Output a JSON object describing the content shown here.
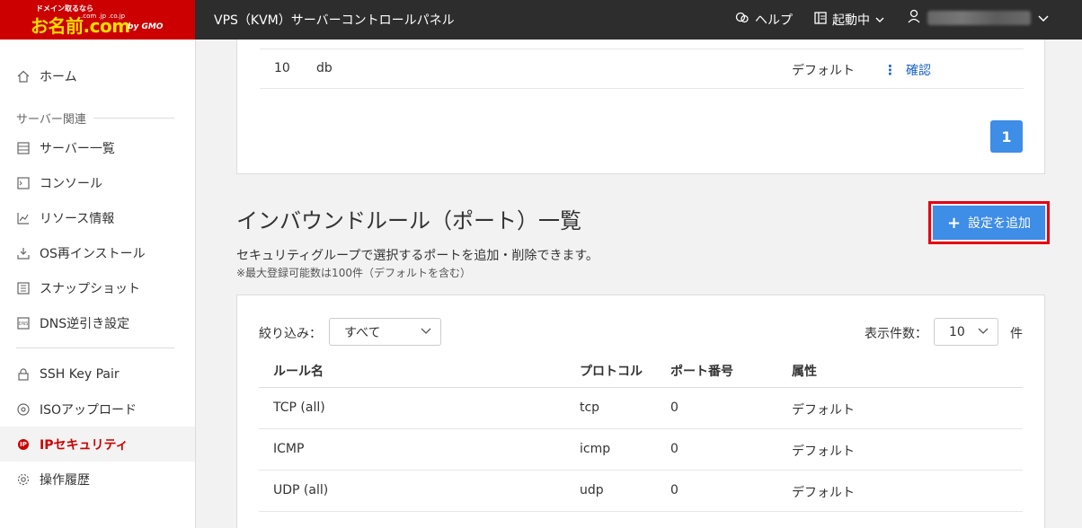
{
  "header": {
    "logo_small": "ドメイン取るなら",
    "logo_main": "お名前.com",
    "logo_tld": ".com .jp .co.jp",
    "logo_gmo": "by GMO",
    "app_title": "VPS（KVM）サーバーコントロールパネル",
    "help_label": "ヘルプ",
    "status_label": "起動中"
  },
  "sidebar": {
    "items": [
      {
        "label": "ホーム",
        "icon": "home-icon"
      },
      {
        "label": "サーバー一覧",
        "icon": "server-list-icon"
      },
      {
        "label": "コンソール",
        "icon": "console-icon"
      },
      {
        "label": "リソース情報",
        "icon": "chart-icon"
      },
      {
        "label": "OS再インストール",
        "icon": "reinstall-icon"
      },
      {
        "label": "スナップショット",
        "icon": "snapshot-icon"
      },
      {
        "label": "DNS逆引き設定",
        "icon": "dns-icon"
      },
      {
        "label": "SSH Key Pair",
        "icon": "lock-icon"
      },
      {
        "label": "ISOアップロード",
        "icon": "disc-icon"
      },
      {
        "label": "IPセキュリティ",
        "icon": "ip-icon"
      },
      {
        "label": "操作履歴",
        "icon": "gear-icon"
      }
    ],
    "section_label": "サーバー関連",
    "ip_badge": "IP"
  },
  "top_table": {
    "row": {
      "no": "10",
      "name": "db",
      "attribute": "デフォルト",
      "action": "確認"
    },
    "page": "1"
  },
  "inbound": {
    "title": "インバウンドルール（ポート）一覧",
    "add_button": "設定を追加",
    "description": "セキュリティグループで選択するポートを追加・削除できます。",
    "note": "※最大登録可能数は100件（デフォルトを含む）",
    "filter_label": "絞り込み：",
    "filter_value": "すべて",
    "count_label": "表示件数：",
    "count_value": "10",
    "count_unit": "件",
    "columns": {
      "name": "ルール名",
      "protocol": "プロトコル",
      "port": "ポート番号",
      "attribute": "属性"
    },
    "rows": [
      {
        "name": "TCP (all)",
        "protocol": "tcp",
        "port": "0",
        "attribute": "デフォルト"
      },
      {
        "name": "ICMP",
        "protocol": "icmp",
        "port": "0",
        "attribute": "デフォルト"
      },
      {
        "name": "UDP (all)",
        "protocol": "udp",
        "port": "0",
        "attribute": "デフォルト"
      }
    ]
  },
  "colors": {
    "brand_red": "#cc0000",
    "button_blue": "#3e8de6",
    "highlight_red": "#e60012",
    "link_blue": "#1a63c4"
  }
}
